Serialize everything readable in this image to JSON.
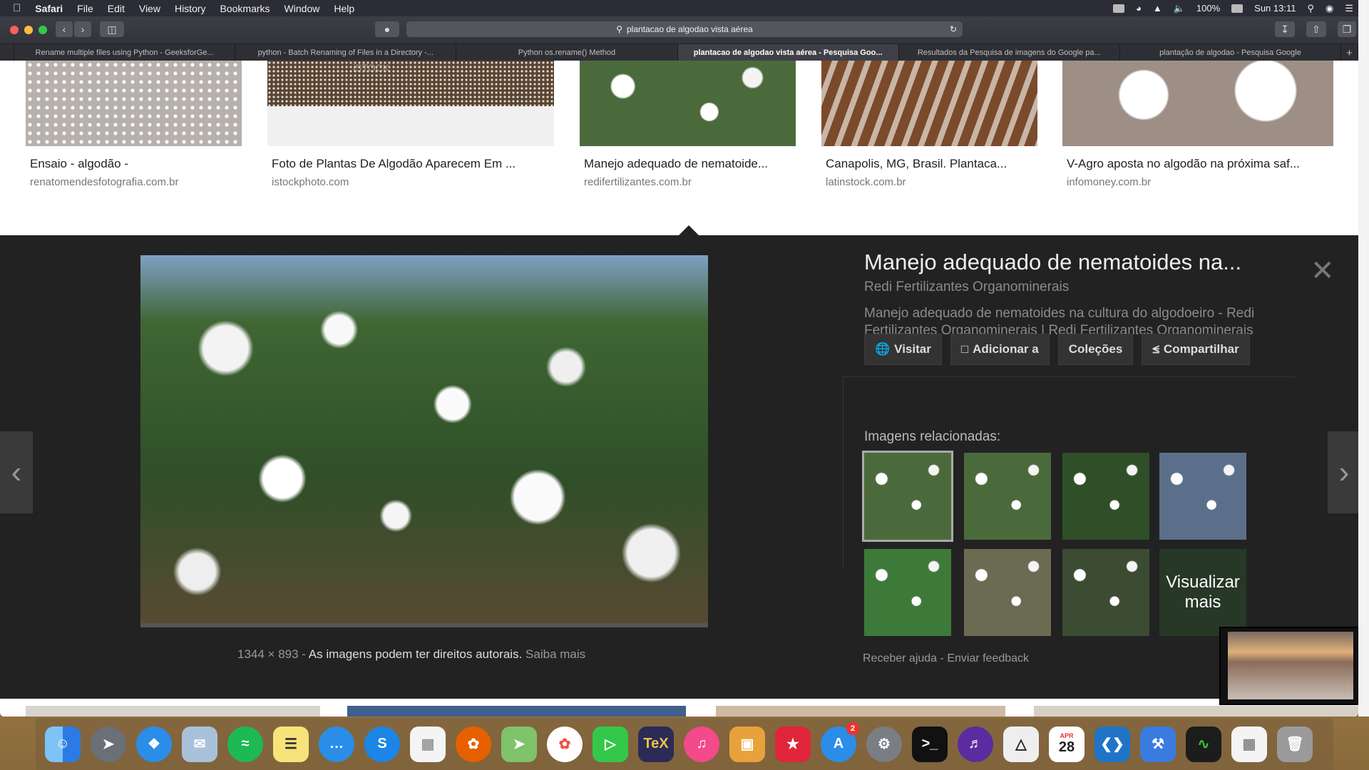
{
  "menubar": {
    "app": "Safari",
    "items": [
      "File",
      "Edit",
      "View",
      "History",
      "Bookmarks",
      "Window",
      "Help"
    ],
    "battery": "100%",
    "clock": "Sun 13:11"
  },
  "browser": {
    "url": "plantacao de algodao vista aérea",
    "tabs": [
      "Rename multiple files using Python - GeeksforGe...",
      "python - Batch Renaming of Files in a Directory -...",
      "Python os.rename() Method",
      "plantacao de algodao vista aérea - Pesquisa Goo...",
      "Resultados da Pesquisa de imagens do Google pa...",
      "plantação de algodao - Pesquisa Google"
    ]
  },
  "results": [
    {
      "title": "Ensaio - algodão -",
      "source": "renatomendesfotografia.com.br"
    },
    {
      "title": "Foto de Plantas De Algodão Aparecem Em ...",
      "source": "istockphoto.com"
    },
    {
      "title": "Manejo adequado de nematoide...",
      "source": "redifertilizantes.com.br"
    },
    {
      "title": "Canapolis, MG, Brasil. Plantaca...",
      "source": "latinstock.com.br"
    },
    {
      "title": "V-Agro aposta no algodão na próxima saf...",
      "source": "infomoney.com.br"
    }
  ],
  "preview": {
    "title": "Manejo adequado de nematoides na...",
    "site": "Redi Fertilizantes Organominerais",
    "description": "Manejo adequado de nematoides na cultura do algodoeiro - Redi Fertilizantes Organominerais | Redi Fertilizantes Organominerais",
    "actions": {
      "visit": "Visitar",
      "add": "Adicionar a",
      "collections": "Coleções",
      "share": "Compartilhar"
    },
    "related_label": "Imagens relacionadas:",
    "more_label": "Visualizar mais",
    "dimensions": "1344 × 893",
    "rights": "As imagens podem ter direitos autorais.",
    "learn": "Saiba mais",
    "help": "Receber ajuda",
    "feedback": "Enviar feedback",
    "sep": "-"
  },
  "watermark": "iSTOCK",
  "dock": {
    "calendar_month": "APR",
    "calendar_day": "28",
    "appstore_badge": "2"
  }
}
